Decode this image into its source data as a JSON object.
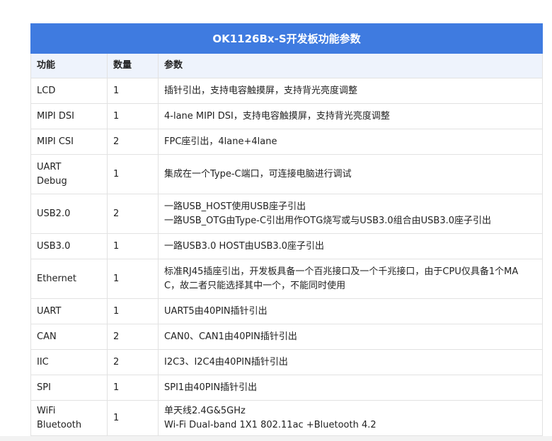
{
  "table": {
    "title": "OK1126Bx-S开发板功能参数",
    "headers": {
      "function": "功能",
      "quantity": "数量",
      "params": "参数"
    },
    "rows": [
      {
        "function": [
          "LCD"
        ],
        "quantity": "1",
        "params": [
          "插针引出，支持电容触摸屏，支持背光亮度调整"
        ]
      },
      {
        "function": [
          "MIPI DSI"
        ],
        "quantity": "1",
        "params": [
          "4-lane MIPI DSI，支持电容触摸屏，支持背光亮度调整"
        ]
      },
      {
        "function": [
          "MIPI CSI"
        ],
        "quantity": "2",
        "params": [
          "FPC座引出，4lane+4lane"
        ]
      },
      {
        "function": [
          "UART",
          "Debug"
        ],
        "quantity": "1",
        "params": [
          "集成在一个Type-C端口，可连接电脑进行调试"
        ]
      },
      {
        "function": [
          "USB2.0"
        ],
        "quantity": "2",
        "params": [
          "一路USB_HOST使用USB座子引出",
          "一路USB_OTG由Type-C引出用作OTG烧写或与USB3.0组合由USB3.0座子引出"
        ]
      },
      {
        "function": [
          "USB3.0"
        ],
        "quantity": "1",
        "params": [
          "一路USB3.0 HOST由USB3.0座子引出"
        ]
      },
      {
        "function": [
          "Ethernet"
        ],
        "quantity": "1",
        "params": [
          "标准RJ45插座引出，开发板具备一个百兆接口及一个千兆接口，由于CPU仅具备1个MA",
          "C，故二者只能选择其中一个，不能同时使用"
        ]
      },
      {
        "function": [
          "UART"
        ],
        "quantity": "1",
        "params": [
          "UART5由40PIN插针引出"
        ]
      },
      {
        "function": [
          "CAN"
        ],
        "quantity": "2",
        "params": [
          "CAN0、CAN1由40PIN插针引出"
        ]
      },
      {
        "function": [
          "IIC"
        ],
        "quantity": "2",
        "params": [
          "I2C3、I2C4由40PIN插针引出"
        ]
      },
      {
        "function": [
          "SPI"
        ],
        "quantity": "1",
        "params": [
          "SPI1由40PIN插针引出"
        ]
      },
      {
        "function": [
          "WiFi",
          "Bluetooth"
        ],
        "quantity": "1",
        "params": [
          "单天线2.4G&5GHz",
          "Wi-Fi Dual-band 1X1 802.11ac +Bluetooth 4.2"
        ]
      }
    ]
  },
  "colors": {
    "title_bg": "#3f7be0",
    "header_bg": "#eef3fc",
    "border": "#e2e2e2"
  }
}
